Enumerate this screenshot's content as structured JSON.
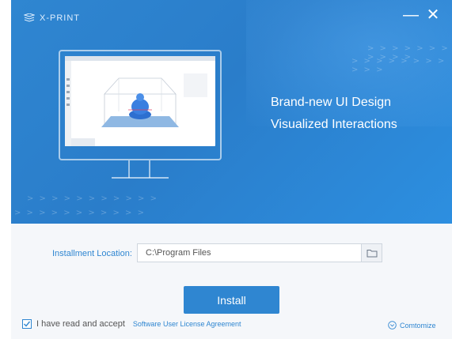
{
  "brand": {
    "name": "X-PRINT"
  },
  "window_controls": {
    "minimize": "—",
    "close": "✕"
  },
  "hero": {
    "headline_1": "Brand-new UI Design",
    "headline_2": "Visualized Interactions",
    "decor_chevrons": "> > > > > > > > > > >"
  },
  "install": {
    "location_label": "Installment Location:",
    "location_value": "C:\\Program Files",
    "button_label": "Install"
  },
  "footer": {
    "agree_text": "I have read and accept",
    "license_link": "Software User License Agreement",
    "customize_label": "Comtomize",
    "agreed": true
  },
  "colors": {
    "accent": "#2f86d1",
    "hero": "#2a7dca"
  },
  "icons": [
    "xprint-logo-icon",
    "folder-icon",
    "checkmark-icon",
    "chevron-circle-down-icon"
  ]
}
